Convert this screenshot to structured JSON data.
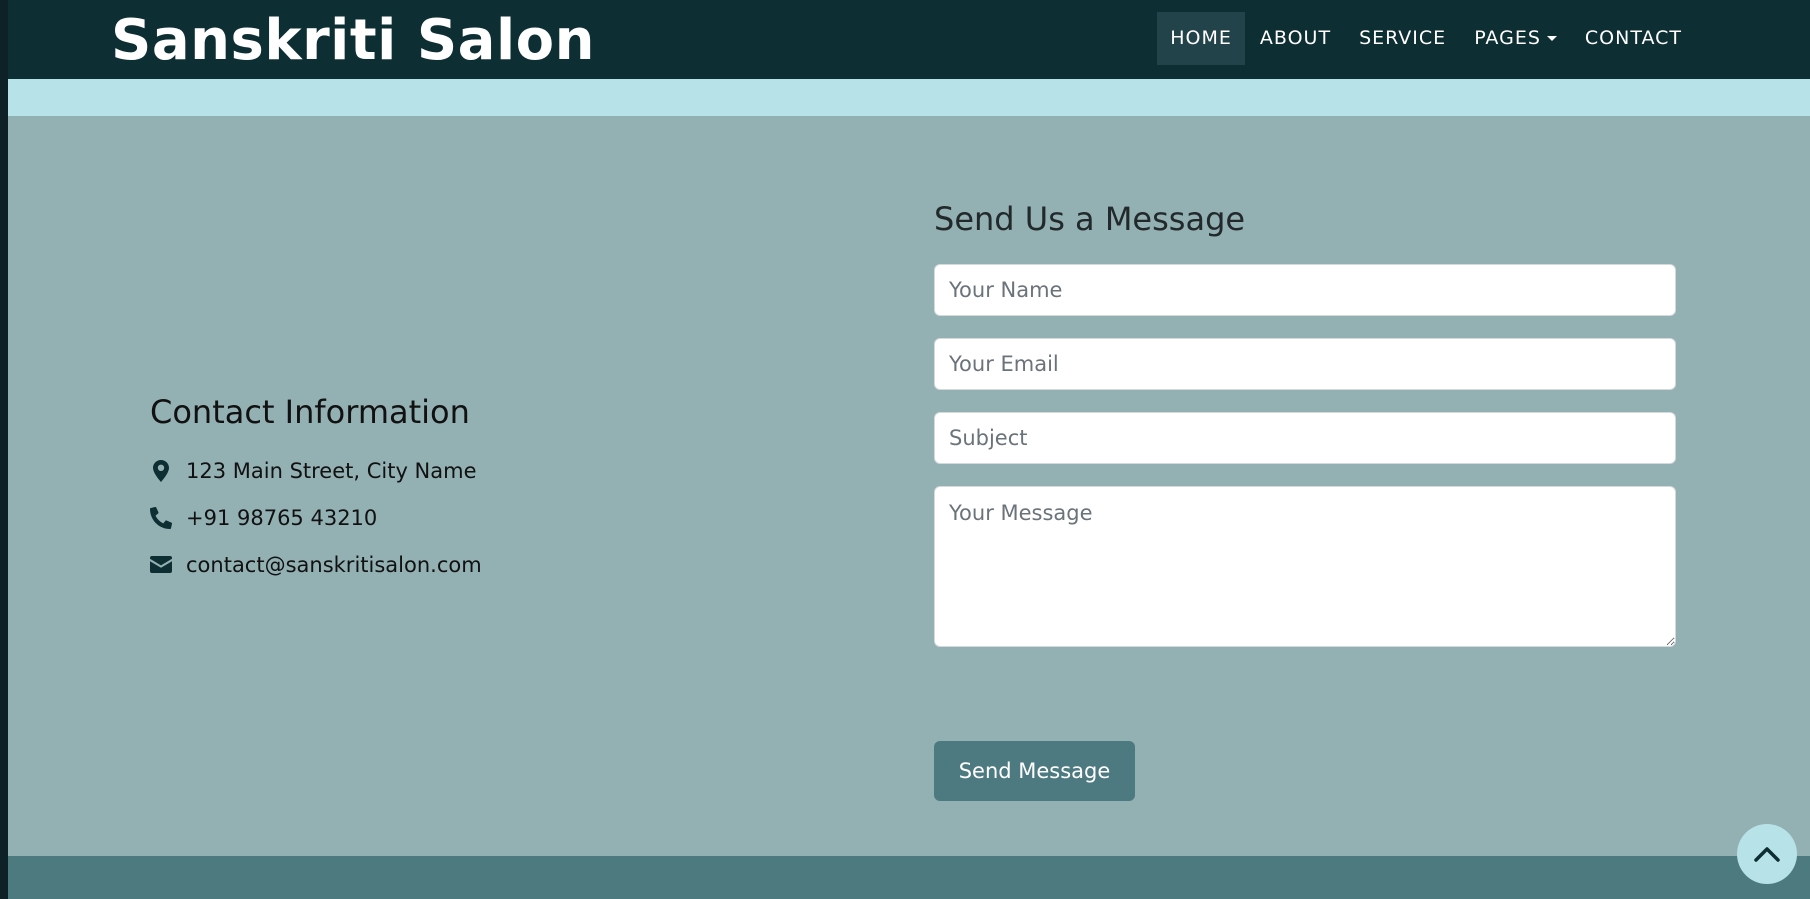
{
  "brand": {
    "name": "Sanskriti Salon"
  },
  "nav": {
    "items": [
      {
        "label": "HOME",
        "active": true
      },
      {
        "label": "ABOUT"
      },
      {
        "label": "SERVICE"
      },
      {
        "label": "PAGES",
        "dropdown": true
      },
      {
        "label": "CONTACT"
      }
    ]
  },
  "contact_info": {
    "title": "Contact Information",
    "address": "123 Main Street, City Name",
    "phone": "+91 98765 43210",
    "email": "contact@sanskritisalon.com"
  },
  "form": {
    "title": "Send Us a Message",
    "name_placeholder": "Your Name",
    "email_placeholder": "Your Email",
    "subject_placeholder": "Subject",
    "message_placeholder": "Your Message",
    "submit_label": "Send Message"
  },
  "icons": {
    "address": "map-marker-icon",
    "phone": "phone-icon",
    "email": "envelope-icon",
    "scroll_top": "chevron-up-icon"
  },
  "colors": {
    "navbar_bg": "#0d2e33",
    "accent": "#4d7a80",
    "section_bg": "#93b0b3",
    "strip_bg": "#b7e2e8"
  }
}
